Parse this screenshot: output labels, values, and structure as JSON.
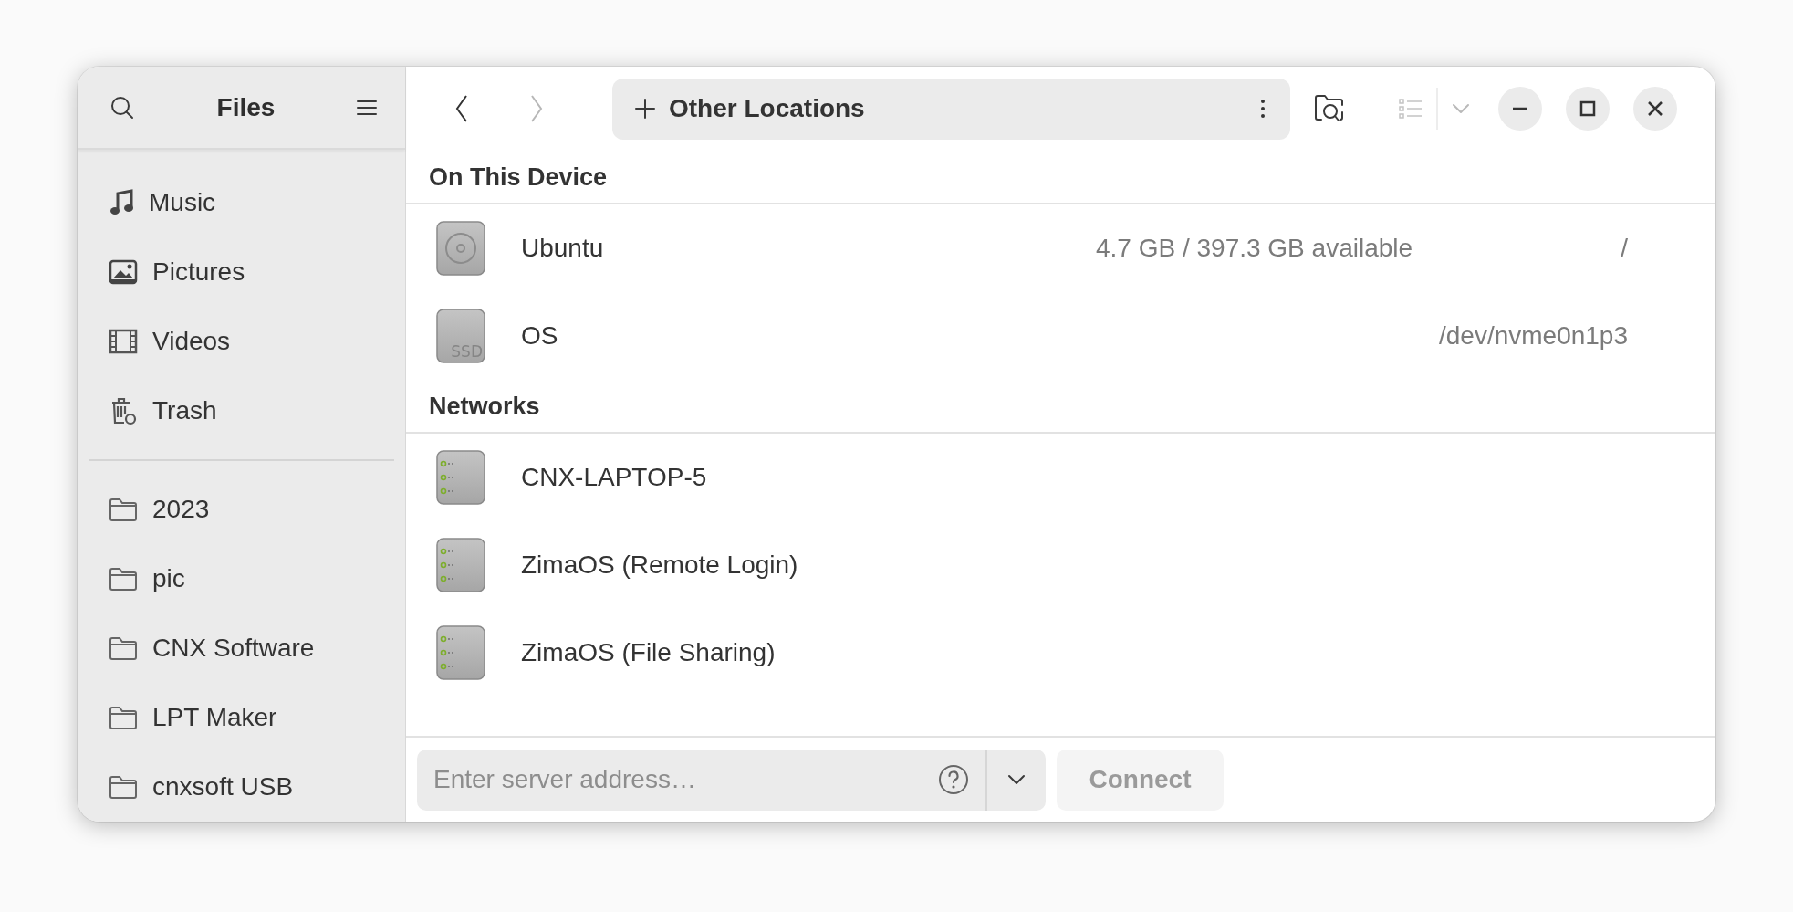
{
  "sidebar": {
    "title": "Files",
    "places": [
      {
        "label": "Music",
        "kind": "music"
      },
      {
        "label": "Pictures",
        "kind": "picture"
      },
      {
        "label": "Videos",
        "kind": "film"
      },
      {
        "label": "Trash",
        "kind": "trash"
      }
    ],
    "bookmarks": [
      {
        "label": "2023",
        "kind": "folder"
      },
      {
        "label": "pic",
        "kind": "folder"
      },
      {
        "label": "CNX Software",
        "kind": "folder"
      },
      {
        "label": "LPT Maker",
        "kind": "folder"
      },
      {
        "label": "cnxsoft USB",
        "kind": "folder"
      }
    ]
  },
  "header": {
    "back_disabled": false,
    "forward_disabled": true,
    "location": "Other Locations",
    "view_disabled": true
  },
  "sections": [
    {
      "title": "On This Device",
      "items": [
        {
          "name": "Ubuntu",
          "kind": "disk",
          "info": "4.7 GB / 397.3 GB available",
          "path": "/"
        },
        {
          "name": "OS",
          "kind": "ssd",
          "icon_text": "SSD",
          "path": "/dev/nvme0n1p3"
        }
      ]
    },
    {
      "title": "Networks",
      "items": [
        {
          "name": "CNX-LAPTOP-5",
          "kind": "server"
        },
        {
          "name": "ZimaOS (Remote Login)",
          "kind": "server"
        },
        {
          "name": "ZimaOS (File Sharing)",
          "kind": "server"
        }
      ]
    }
  ],
  "connect_bar": {
    "placeholder": "Enter server address…",
    "button": "Connect",
    "button_disabled": true
  }
}
